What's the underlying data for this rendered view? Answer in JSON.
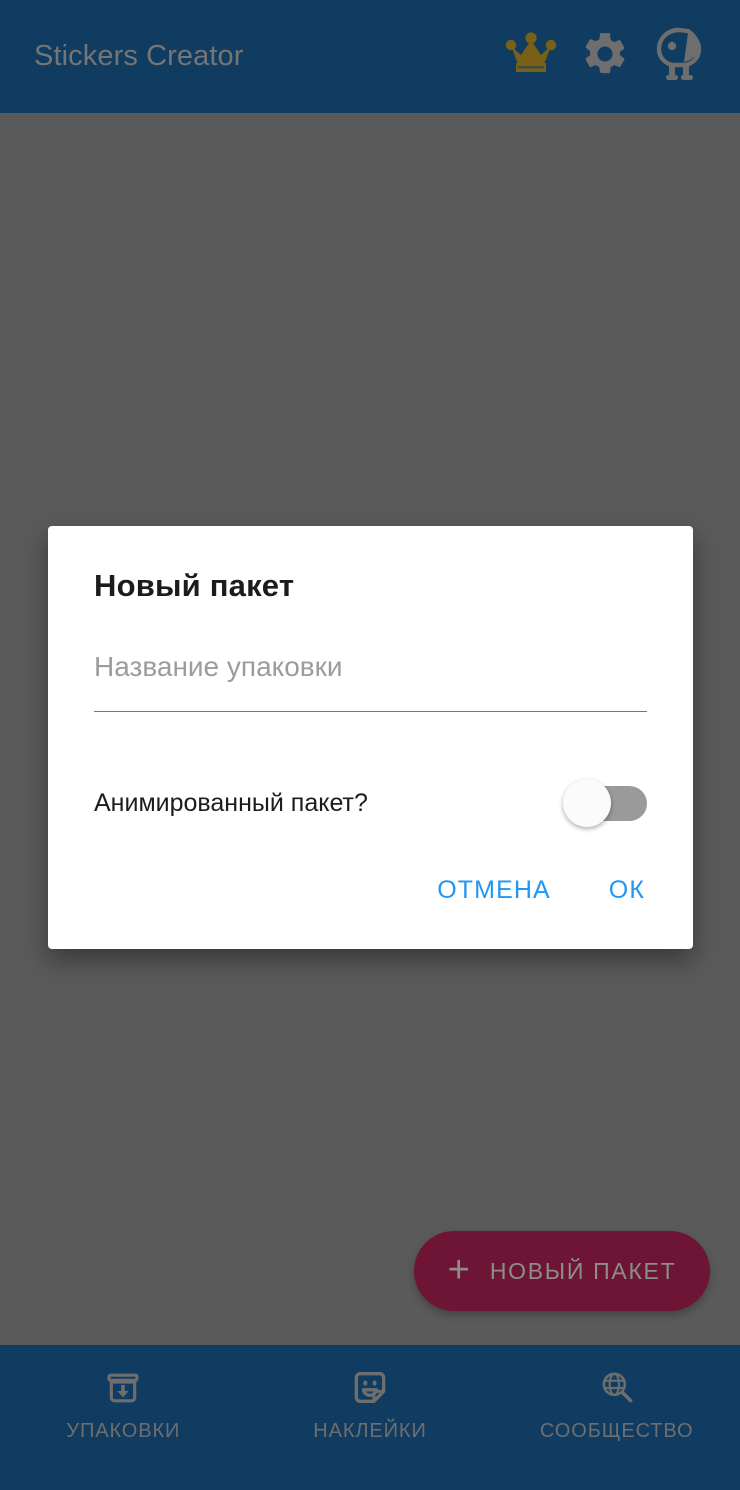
{
  "app_bar": {
    "title": "Stickers Creator",
    "background_color": "#103c61",
    "title_color": "#757575",
    "actions": [
      {
        "name": "crown-icon",
        "label": "Premium",
        "color": "#7a6016"
      },
      {
        "name": "gear-icon",
        "label": "Settings",
        "color": "#6e6e6e"
      },
      {
        "name": "mascot-bird-icon",
        "label": "Mascot",
        "color": "#6e6e6e"
      }
    ]
  },
  "fab": {
    "plus": "+",
    "label": "НОВЫЙ ПАКЕТ",
    "background_color": "#6e1435",
    "text_color": "#8d8d8d"
  },
  "bottom_nav": {
    "background_color": "#103c61",
    "label_color": "#6e6e6e",
    "items": [
      {
        "label": "УПАКОВКИ",
        "icon": "archive-download-icon"
      },
      {
        "label": "НАКЛЕЙКИ",
        "icon": "sticker-smiley-icon"
      },
      {
        "label": "СООБЩЕСТВО",
        "icon": "globe-search-icon"
      }
    ]
  },
  "dialog": {
    "title": "Новый пакет",
    "pack_name": {
      "value": "",
      "placeholder": "Название упаковки"
    },
    "animated_toggle": {
      "label": "Анимированный пакет?",
      "state": "off"
    },
    "actions": {
      "cancel_label": "ОТМЕНА",
      "ok_label": "ОК",
      "color": "#2196f3"
    },
    "background_color": "#ffffff"
  },
  "overlay": {
    "dim_color": "#5a5a5a"
  }
}
